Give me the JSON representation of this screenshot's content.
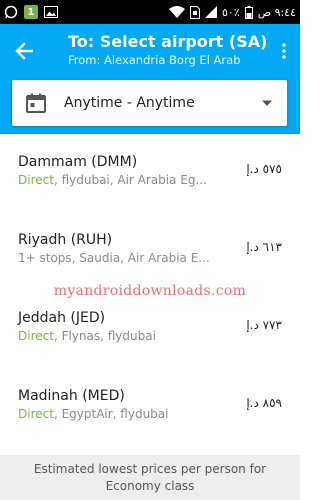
{
  "status_bar": {
    "time": "٩:٤٤ ص",
    "battery": "٥٠٪",
    "icons": [
      "whatsapp-icon",
      "notification-badge-icon",
      "image-icon",
      "wifi-icon",
      "sim-icon",
      "signal-icon",
      "battery-icon"
    ],
    "badge": "1"
  },
  "app_bar": {
    "title": "To: Select airport (SA)",
    "subtitle": "From: Alexandria Borg El Arab",
    "color": "#03a9f4"
  },
  "date_filter": {
    "value": "Anytime - Anytime"
  },
  "results": [
    {
      "city": "Dammam (DMM)",
      "stops": "Direct",
      "carriers": ", flydubai, Air Arabia Eg...",
      "price": "٥٧٥ د.إ"
    },
    {
      "city": "Riyadh (RUH)",
      "stops": "",
      "carriers": "1+ stops, Saudia, Air Arabia E...",
      "price": "٦١٣ د.إ"
    },
    {
      "city": "Jeddah (JED)",
      "stops": "Direct",
      "carriers": ", Flynas, flydubai",
      "price": "٧٧٣ د.إ"
    },
    {
      "city": "Madinah (MED)",
      "stops": "Direct",
      "carriers": ", EgyptAir, flydubai",
      "price": "٨٥٩ د.إ"
    }
  ],
  "watermark": "myandroiddownloads.com",
  "footer": {
    "line1": "Estimated lowest prices per person for",
    "line2": "Economy class"
  },
  "colors": {
    "direct": "#7cb342",
    "secondary_text": "#8a8a8a"
  }
}
